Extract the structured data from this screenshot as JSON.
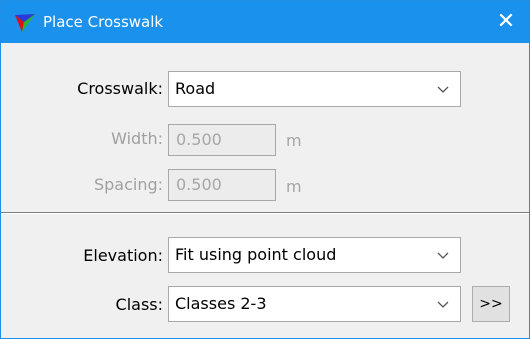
{
  "window": {
    "title": "Place Crosswalk"
  },
  "icons": {
    "app": "app-logo-icon",
    "close": "close-icon",
    "dropdown": "chevron-down-icon"
  },
  "colors": {
    "titlebar": "#1b91ee",
    "window_bg": "#f0f0f0",
    "disabled_text": "#a6a6a6"
  },
  "crosswalk": {
    "label": "Crosswalk:",
    "value": "Road"
  },
  "width": {
    "label": "Width:",
    "value": "0.500",
    "unit": "m"
  },
  "spacing": {
    "label": "Spacing:",
    "value": "0.500",
    "unit": "m"
  },
  "elevation": {
    "label": "Elevation:",
    "value": "Fit using point cloud"
  },
  "class": {
    "label": "Class:",
    "value": "Classes 2-3",
    "more_button": ">>"
  }
}
